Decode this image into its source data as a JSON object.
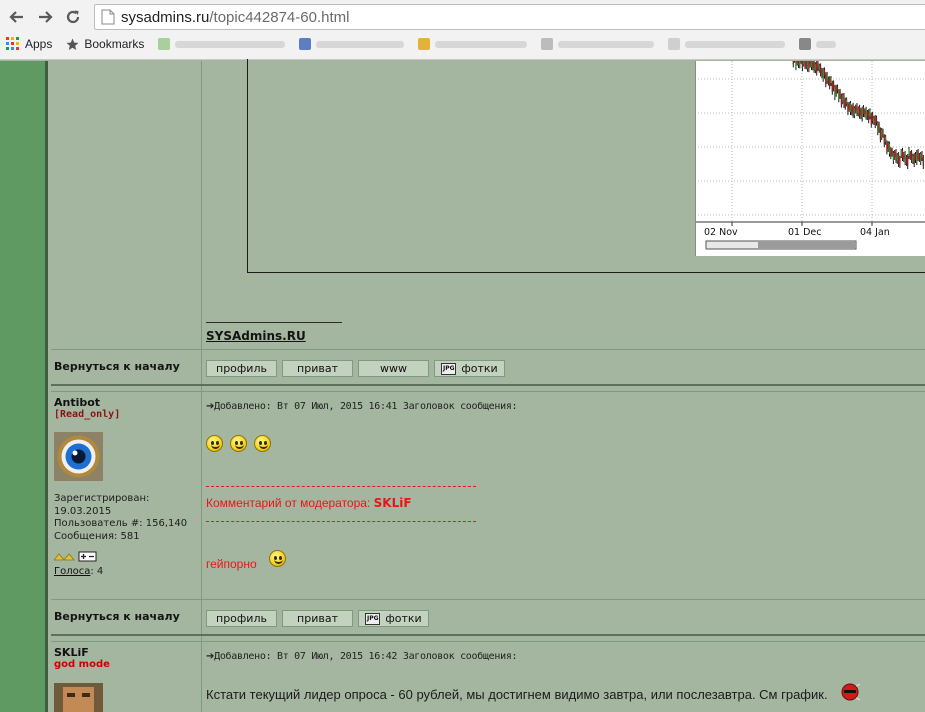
{
  "browser": {
    "url_host": "sysadmins.ru",
    "url_path": "/topic442874-60.html",
    "bookmarks": [
      {
        "label": "Apps",
        "icon": "apps-grid-icon"
      },
      {
        "label": "Bookmarks",
        "icon": "bookmark-star-icon"
      }
    ]
  },
  "chart": {
    "x_ticks": [
      "02 Nov",
      "01 Dec",
      "04 Jan"
    ]
  },
  "signature": {
    "link": "SYSAdmins.RU"
  },
  "post_actions_1": {
    "back_to_top": "Вернуться к началу",
    "buttons": [
      "профиль",
      "приват",
      "www",
      "фотки"
    ]
  },
  "post_2": {
    "username": "Antibot",
    "rank": "[Read_only]",
    "registered_label": "Зарегистрирован:",
    "registered_date": "19.03.2015",
    "user_number": "Пользователь #: 156,140",
    "messages": "Сообщения: 581",
    "votes_label": "Голоса",
    "votes_value": ": 4",
    "header": "Добавлено: Вт 07 Июл, 2015 16:41   Заголовок сообщения:",
    "moderator_comment_label": "Комментарий от модератора: ",
    "moderator_name": "SKLiF",
    "body": "гейпорно"
  },
  "post_actions_2": {
    "back_to_top": "Вернуться к началу",
    "buttons": [
      "профиль",
      "приват",
      "фотки"
    ]
  },
  "post_3": {
    "username": "SKLiF",
    "rank": "god mode",
    "header": "Добавлено: Вт 07 Июл, 2015 16:42   Заголовок сообщения:",
    "body": "Кстати текущий лидер опроса - 60 рублей, мы достигнем видимо завтра, или послезавтра. См график."
  },
  "colors": {
    "rail": "#5e9a61",
    "page_bg": "#a5b6a0",
    "moderator_red": "#e81616"
  }
}
